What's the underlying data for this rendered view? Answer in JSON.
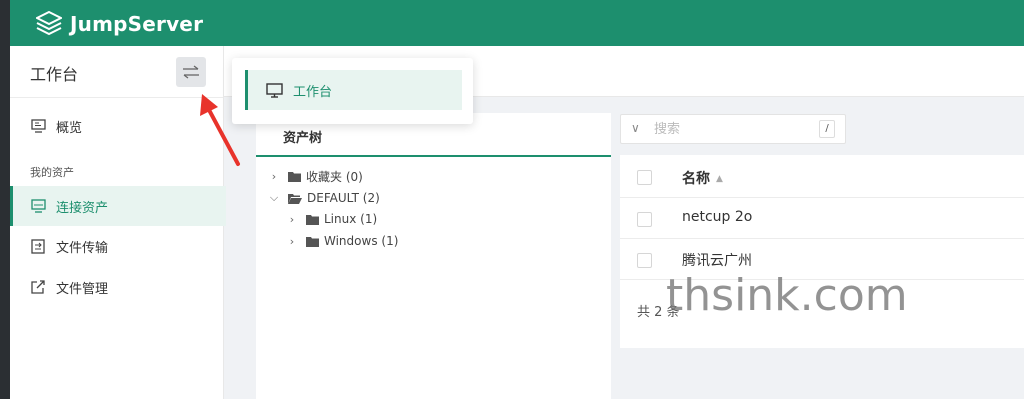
{
  "app": {
    "brand": "JumpServer",
    "accent": "#1d8f6e"
  },
  "sidebar": {
    "title": "工作台",
    "switch_icon": "swap-icon",
    "items": [
      {
        "label": "概览",
        "icon": "monitor-icon"
      },
      {
        "label": "连接资产",
        "icon": "screen-icon",
        "active": true
      },
      {
        "label": "文件传输",
        "icon": "file-transfer-icon"
      },
      {
        "label": "文件管理",
        "icon": "external-link-icon"
      }
    ],
    "group_label": "我的资产"
  },
  "dropdown": {
    "item_label": "工作台",
    "icon": "desktop-icon"
  },
  "tree": {
    "tab_label": "资产树",
    "nodes": [
      {
        "label": "收藏夹 (0)"
      },
      {
        "label": "DEFAULT (2)"
      },
      {
        "label": "Linux (1)"
      },
      {
        "label": "Windows (1)"
      }
    ]
  },
  "search": {
    "placeholder": "搜索",
    "shortcut": "/"
  },
  "table": {
    "column_name": "名称",
    "rows": [
      {
        "name": "netcup 2o"
      },
      {
        "name": "腾讯云广州"
      }
    ],
    "total": "共 2 条"
  },
  "watermark": "thsink.com"
}
